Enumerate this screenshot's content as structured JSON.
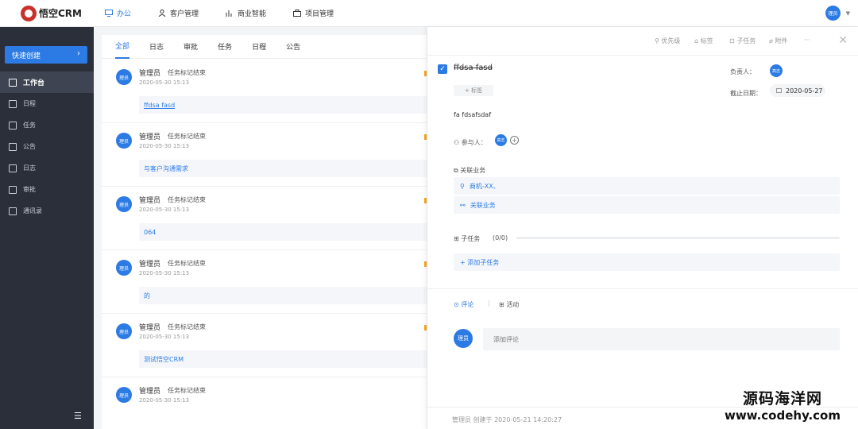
{
  "header": {
    "logo_text": "悟空CRM",
    "nav": [
      {
        "label": "办公",
        "icon": "monitor-icon",
        "active": true
      },
      {
        "label": "客户管理",
        "icon": "user-icon",
        "active": false
      },
      {
        "label": "商业智能",
        "icon": "bar-chart-icon",
        "active": false
      },
      {
        "label": "项目管理",
        "icon": "briefcase-icon",
        "active": false
      }
    ],
    "user_avatar": "理员"
  },
  "sidebar": {
    "quick_create": "快速创建",
    "items": [
      {
        "label": "工作台",
        "icon": "monitor-icon",
        "active": true
      },
      {
        "label": "日程",
        "icon": "calendar-icon"
      },
      {
        "label": "任务",
        "icon": "checkbox-icon"
      },
      {
        "label": "公告",
        "icon": "megaphone-icon"
      },
      {
        "label": "日志",
        "icon": "journal-icon"
      },
      {
        "label": "审批",
        "icon": "stamp-icon"
      },
      {
        "label": "通讯录",
        "icon": "contacts-icon"
      }
    ]
  },
  "list": {
    "tabs": [
      "全部",
      "日志",
      "审批",
      "任务",
      "日程",
      "公告"
    ],
    "active_tab": "全部",
    "items": [
      {
        "avatar": "理员",
        "name": "管理员",
        "action": "任务标记结束",
        "time": "2020-05-30 15:13",
        "content": "ffdsa fasd"
      },
      {
        "avatar": "理员",
        "name": "管理员",
        "action": "任务标记结束",
        "time": "2020-05-30 15:13",
        "content": "与客户沟通需求"
      },
      {
        "avatar": "理员",
        "name": "管理员",
        "action": "任务标记结束",
        "time": "2020-05-30 15:13",
        "content": "064"
      },
      {
        "avatar": "理员",
        "name": "管理员",
        "action": "任务标记结束",
        "time": "2020-05-30 15:13",
        "content": "的"
      },
      {
        "avatar": "理员",
        "name": "管理员",
        "action": "任务标记结束",
        "time": "2020-05-30 15:13",
        "content": "测试悟空CRM"
      },
      {
        "avatar": "理员",
        "name": "管理员",
        "action": "任务标记结束",
        "time": "2020-05-30 15:13",
        "content": ""
      }
    ]
  },
  "detail": {
    "toolbar": {
      "priority": "优先级",
      "tag": "标签",
      "subtask": "子任务",
      "attachment": "附件",
      "more": "···"
    },
    "task_title": "ffdsa fasd",
    "tag_button": "+ 标签",
    "owner_label": "负责人：",
    "owner_avatar": "高志",
    "due_label": "截止日期：",
    "due_date": "2020-05-27",
    "description": "fa fdsafsdaf",
    "participants_label": "参与人：",
    "participant_avatar": "高志",
    "related_label": "关联业务",
    "related_items": [
      "商机-XX、",
      "关联业务"
    ],
    "subtask_label": "子任务",
    "subtask_count": "(0/0)",
    "subtask_progress": 0,
    "add_subtask": "+ 添加子任务",
    "comment_tabs": [
      "评论",
      "活动"
    ],
    "comment_avatar": "理员",
    "comment_placeholder": "添加评论",
    "footer": "管理员 创建于 2020-05-21 14:20:27"
  },
  "watermark": {
    "cn": "源码海洋网",
    "url": "www.codehy.com"
  },
  "colors": {
    "accent": "#2c7be5",
    "sidebar": "#2b2f3a",
    "marker": "#f5a623"
  }
}
